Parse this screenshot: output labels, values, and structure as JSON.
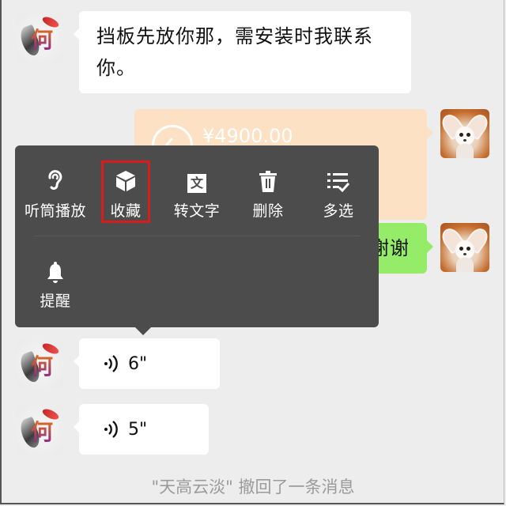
{
  "conversation": {
    "messages": [
      {
        "id": "m1",
        "side": "left",
        "sender": "何",
        "type": "text",
        "text_line1": "挡板先放你那，需安装时我联系",
        "text_line2": "你。"
      },
      {
        "id": "m2",
        "side": "right",
        "type": "transfer",
        "amount": "¥4900.00"
      },
      {
        "id": "m3",
        "side": "right",
        "type": "text",
        "text": "谢谢"
      },
      {
        "id": "m4",
        "side": "left",
        "sender": "何",
        "type": "voice",
        "duration": "6\""
      },
      {
        "id": "m5",
        "side": "left",
        "sender": "何",
        "type": "voice",
        "duration": "5\""
      }
    ],
    "system_message": "\"天高云淡\" 撤回了一条消息"
  },
  "avatars": {
    "left": {
      "label": "何",
      "icon": "calligraphy-koi-avatar"
    },
    "right": {
      "icon": "fennec-fox-avatar"
    }
  },
  "context_menu": {
    "items": [
      {
        "label": "听筒播放",
        "icon": "ear-icon"
      },
      {
        "label": "收藏",
        "icon": "cube-icon",
        "highlighted": true
      },
      {
        "label": "转文字",
        "icon": "text-convert-icon",
        "icon_glyph": "文"
      },
      {
        "label": "删除",
        "icon": "trash-icon"
      },
      {
        "label": "多选",
        "icon": "multi-select-icon"
      },
      {
        "label": "提醒",
        "icon": "bell-icon"
      }
    ],
    "highlight_color": "#d81b1b"
  },
  "colors": {
    "background": "#ededed",
    "menu_background": "#4c4c4c",
    "sent_bubble": "#95ec69",
    "transfer_bubble": "#fde1c5",
    "system_text": "#9b9b9b"
  }
}
